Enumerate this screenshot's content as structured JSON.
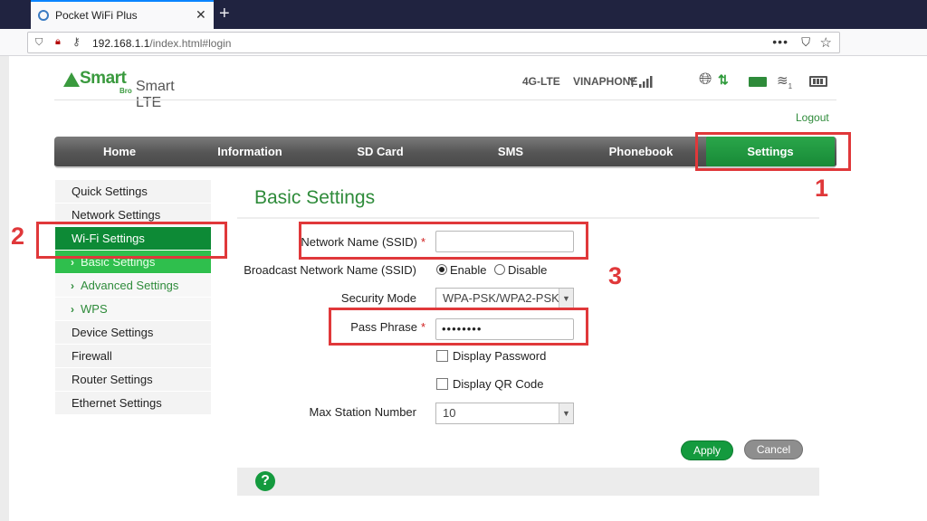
{
  "browser": {
    "tab_title": "Pocket WiFi Plus",
    "tab_close": "✕",
    "new_tab": "+",
    "url_host": "192.168.1.1",
    "url_path": "/index.html#login",
    "menu_dots": "•••",
    "pocket_icon": "pocket-icon",
    "bookmark_icon": "star-icon"
  },
  "brand": {
    "logo_word": "Smart",
    "logo_sub": "Bro",
    "product": "Smart LTE"
  },
  "status": {
    "network_type": "4G-LTE",
    "operator": "VINAPHONE",
    "signal_bars": 4,
    "data_arrows": "⇅",
    "wifi_clients": "1"
  },
  "logout_label": "Logout",
  "nav": {
    "items": [
      "Home",
      "Information",
      "SD Card",
      "SMS",
      "Phonebook",
      "Settings"
    ],
    "active": "Settings"
  },
  "sidebar": {
    "items": [
      {
        "label": "Quick Settings",
        "level": 0
      },
      {
        "label": "Network Settings",
        "level": 0
      },
      {
        "label": "Wi-Fi Settings",
        "level": 0,
        "active": true
      },
      {
        "label": "Basic Settings",
        "level": 1,
        "active": true
      },
      {
        "label": "Advanced Settings",
        "level": 1
      },
      {
        "label": "WPS",
        "level": 1
      },
      {
        "label": "Device Settings",
        "level": 0
      },
      {
        "label": "Firewall",
        "level": 0
      },
      {
        "label": "Router Settings",
        "level": 0
      },
      {
        "label": "Ethernet Settings",
        "level": 0
      }
    ],
    "chevron": "›"
  },
  "form": {
    "title": "Basic Settings",
    "ssid_label": "Network Name (SSID)",
    "ssid_value": "",
    "broadcast_label": "Broadcast Network Name (SSID)",
    "broadcast_enable": "Enable",
    "broadcast_disable": "Disable",
    "broadcast_selected": "Enable",
    "security_label": "Security Mode",
    "security_value": "WPA-PSK/WPA2-PSK",
    "pass_label": "Pass Phrase",
    "pass_value": "••••••••",
    "display_password": "Display Password",
    "display_qr": "Display QR Code",
    "max_station_label": "Max Station Number",
    "max_station_value": "10",
    "required_mark": "*",
    "apply": "Apply",
    "cancel": "Cancel",
    "help": "?"
  },
  "annotations": {
    "step1": "1",
    "step2": "2",
    "step3": "3",
    "color": "#e0383a"
  },
  "colors": {
    "brand_green": "#2e8b3a",
    "nav_active": "#188a37",
    "sidebar_active": "#0d8a36"
  }
}
